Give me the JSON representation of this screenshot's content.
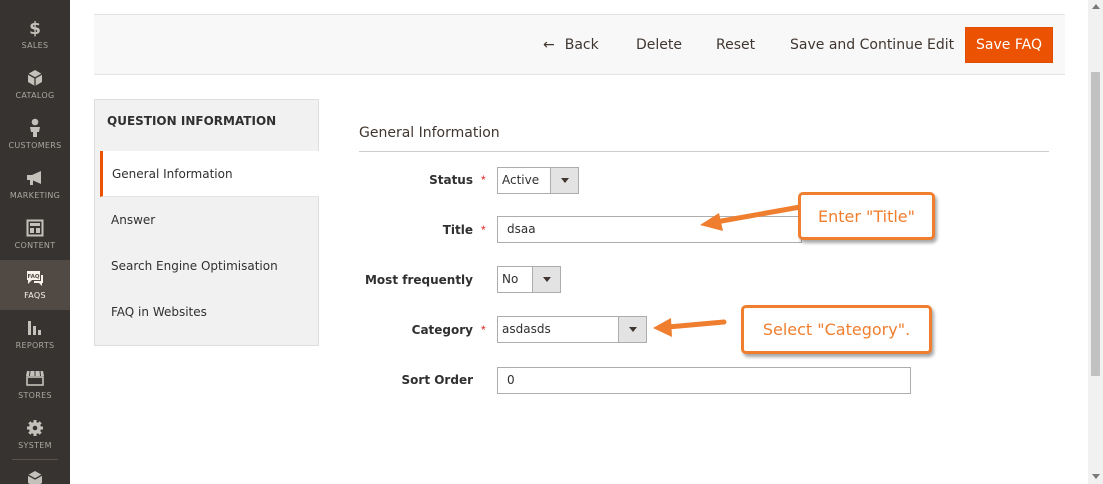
{
  "sidebar": {
    "items": [
      {
        "label": "SALES",
        "icon": "dollar-icon"
      },
      {
        "label": "CATALOG",
        "icon": "cube-icon"
      },
      {
        "label": "CUSTOMERS",
        "icon": "person-icon"
      },
      {
        "label": "MARKETING",
        "icon": "megaphone-icon"
      },
      {
        "label": "CONTENT",
        "icon": "layout-icon"
      },
      {
        "label": "FAQS",
        "icon": "faq-chat-icon",
        "active": true
      },
      {
        "label": "REPORTS",
        "icon": "bar-chart-icon"
      },
      {
        "label": "STORES",
        "icon": "storefront-icon"
      },
      {
        "label": "SYSTEM",
        "icon": "gear-icon"
      },
      {
        "label": "",
        "icon": "box-icon"
      }
    ]
  },
  "actions": {
    "back": "Back",
    "delete": "Delete",
    "reset": "Reset",
    "save_continue": "Save and Continue Edit",
    "save": "Save FAQ"
  },
  "tabs": {
    "title": "QUESTION INFORMATION",
    "items": [
      {
        "label": "General Information",
        "active": true
      },
      {
        "label": "Answer"
      },
      {
        "label": "Search Engine Optimisation"
      },
      {
        "label": "FAQ in Websites"
      }
    ]
  },
  "form": {
    "section_title": "General Information",
    "status": {
      "label": "Status",
      "value": "Active",
      "required": true
    },
    "title": {
      "label": "Title",
      "value": "dsaa",
      "required": true
    },
    "most_frequently": {
      "label": "Most frequently",
      "value": "No",
      "required": false
    },
    "category": {
      "label": "Category",
      "value": "asdasds",
      "required": true
    },
    "sort_order": {
      "label": "Sort Order",
      "value": "0",
      "required": false
    }
  },
  "callouts": {
    "title_hint": "Enter \"Title\"",
    "category_hint": "Select \"Category\"."
  },
  "colors": {
    "accent": "#eb5202",
    "callout": "#f07e2f",
    "sidebar_bg": "#373330",
    "sidebar_active": "#514943",
    "required": "#e22626"
  }
}
